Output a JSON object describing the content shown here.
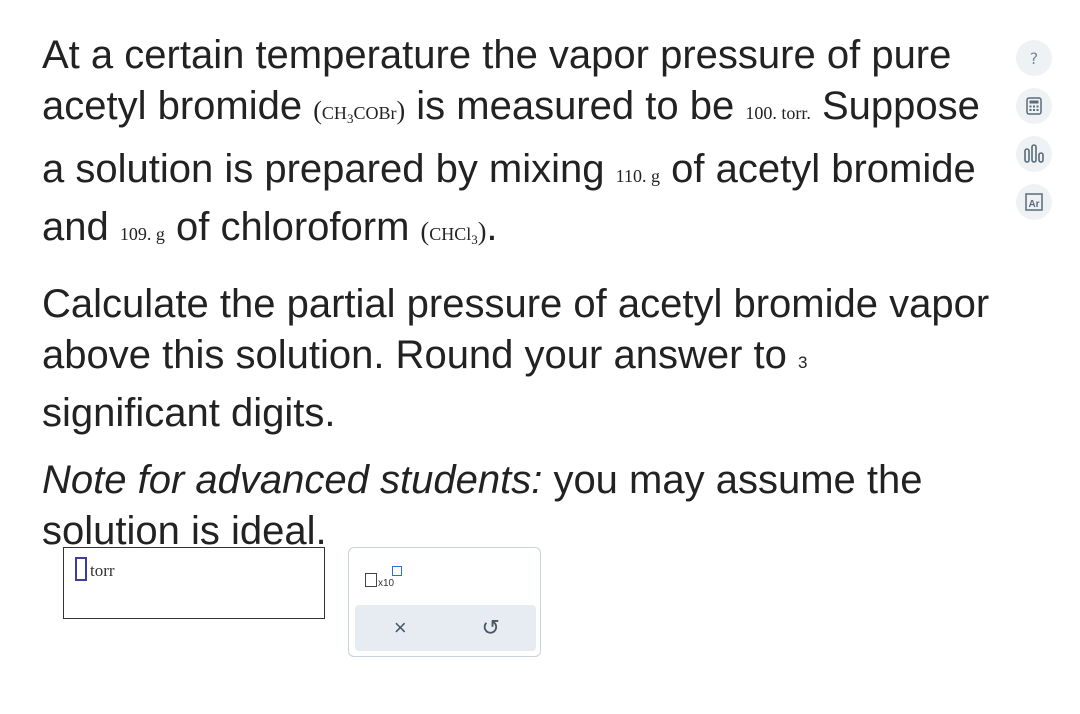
{
  "question": {
    "p1": {
      "s1": "At a certain temperature the vapor pressure of pure acetyl bromide",
      "formula1_a": "CH",
      "formula1_sub": "3",
      "formula1_b": "COBr",
      "s2": "is measured to be",
      "pressure": "100. torr.",
      "s3": "Suppose a solution is prepared by mixing",
      "mass1": "110. g",
      "s4": "of acetyl bromide and",
      "mass2": "109. g",
      "s5": "of chloroform",
      "formula2_a": "CHCl",
      "formula2_sub": "3",
      "s6": "."
    },
    "p2": {
      "text": "Calculate the partial pressure of acetyl bromide vapor above this solution. Round your answer to",
      "digits": "3",
      "tail": "significant digits."
    },
    "p3": {
      "italic": "Note for advanced students:",
      "text": "you may assume the solution is ideal."
    }
  },
  "answer": {
    "value": "",
    "unit": "torr"
  },
  "keypad": {
    "x10_label": "x10",
    "clear_glyph": "×",
    "undo_glyph": "↺"
  },
  "tools": {
    "help_glyph": "?",
    "icons": [
      "help-icon",
      "calculator-icon",
      "chart-icon",
      "periodic-table-icon"
    ],
    "accent": "#2b6fd6"
  }
}
